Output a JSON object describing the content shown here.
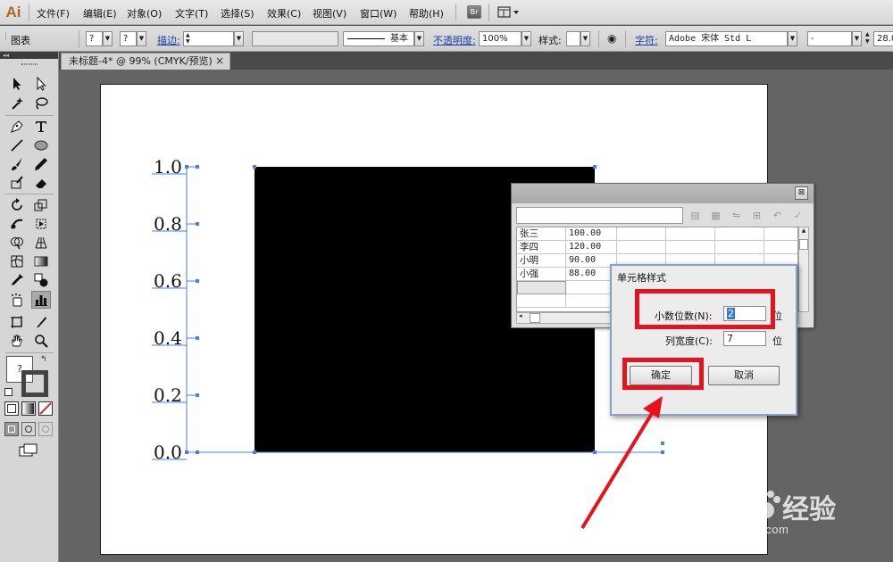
{
  "app": {
    "logo": "Ai"
  },
  "menu": {
    "items": [
      "文件(F)",
      "编辑(E)",
      "对象(O)",
      "文字(T)",
      "选择(S)",
      "效果(C)",
      "视图(V)",
      "窗口(W)",
      "帮助(H)"
    ],
    "bridge_label": "Br"
  },
  "control_bar": {
    "object_type": "图表",
    "fill_value": "?",
    "stroke_value": "?",
    "stroke_label": "描边:",
    "stroke_style_label": "基本",
    "opacity_label": "不透明度:",
    "opacity_value": "100%",
    "style_label": "样式:",
    "char_label": "字符:",
    "font_family": "Adobe 宋体 Std L",
    "font_style": "-",
    "font_size": "28.0"
  },
  "document": {
    "tab_title": "未标题-4* @ 99% (CMYK/预览)",
    "tab_close": "×"
  },
  "tools_panel": {
    "head": "◂◂",
    "fill_swatch_label": "?"
  },
  "chart_data": {
    "type": "bar",
    "yticks": [
      "1.0",
      "0.8",
      "0.6",
      "0.4",
      "0.2",
      "0.0"
    ],
    "ylim": [
      0,
      1.0
    ],
    "bar_value": 1.0,
    "bar_color": "#000000",
    "xlabel": "",
    "ylabel": ""
  },
  "data_window": {
    "close": "⊠",
    "rows": [
      {
        "name": "张三",
        "value": "100.00"
      },
      {
        "name": "李四",
        "value": "120.00"
      },
      {
        "name": "小明",
        "value": "90.00"
      },
      {
        "name": "小强",
        "value": "88.00"
      }
    ]
  },
  "dialog": {
    "title": "单元格样式",
    "decimals_label": "小数位数(N):",
    "decimals_value": "2",
    "decimals_unit": "位",
    "width_label": "列宽度(C):",
    "width_value": "7",
    "width_unit": "位",
    "ok_label": "确定",
    "cancel_label": "取消"
  },
  "colors": {
    "highlight": "#e8121c",
    "selection": "#4a7fe0"
  },
  "watermark": {
    "brand": "Bai",
    "brand2": "经验",
    "url": "jingyan.baidu.com"
  }
}
